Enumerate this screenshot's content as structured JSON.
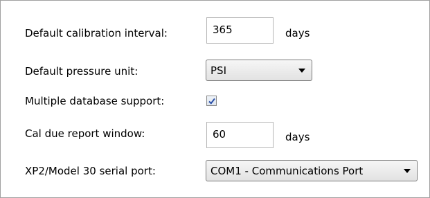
{
  "settings": {
    "calibration_interval": {
      "label": "Default calibration interval:",
      "value": "365",
      "unit": "days"
    },
    "pressure_unit": {
      "label": "Default pressure unit:",
      "selected": "PSI"
    },
    "multiple_db": {
      "label": "Multiple database support:",
      "checked": true
    },
    "cal_due_window": {
      "label": "Cal due report window:",
      "value": "60",
      "unit": "days"
    },
    "serial_port": {
      "label": "XP2/Model 30 serial port:",
      "selected": "COM1 - Communications Port"
    }
  },
  "colors": {
    "checkmark": "#2a4fa8",
    "border": "#a0a0a0"
  }
}
